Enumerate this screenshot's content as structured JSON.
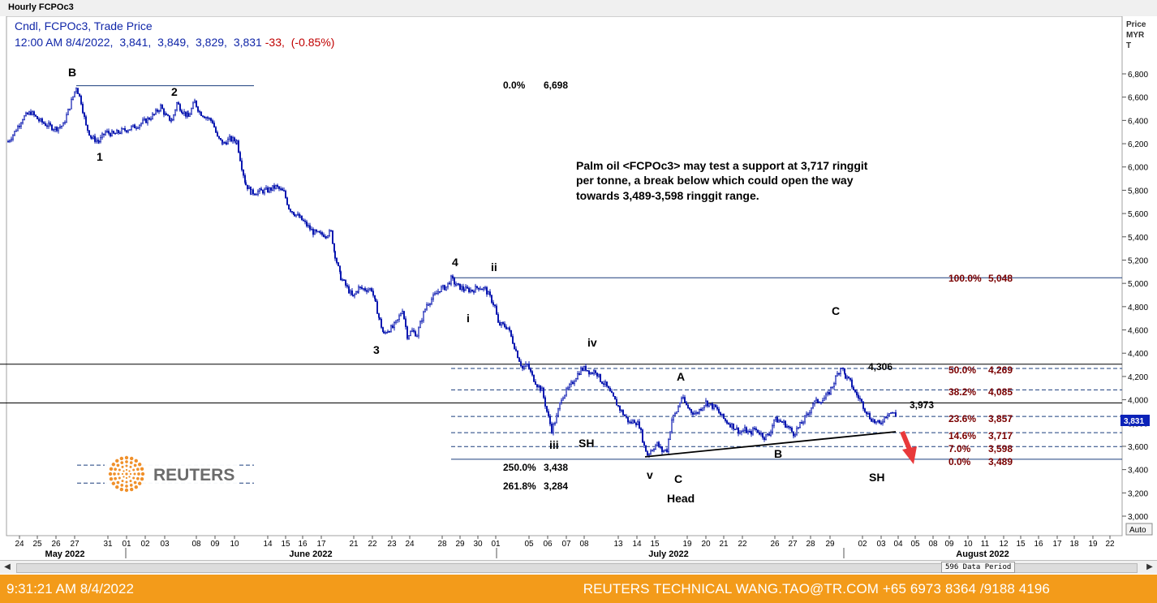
{
  "window": {
    "title": "Hourly FCPOc3"
  },
  "header": {
    "line1": "Cndl, FCPOc3, Trade Price",
    "time": "12:00 AM 8/4/2022,",
    "open": "3,841,",
    "high": "3,849,",
    "low": "3,829,",
    "close": "3,831",
    "change": "-33,",
    "change_pct": "(-0.85%)"
  },
  "axis": {
    "label_lines": [
      "Price",
      "MYR",
      "T"
    ],
    "ticks": [
      "6,800",
      "6,600",
      "6,400",
      "6,200",
      "6,000",
      "5,800",
      "5,600",
      "5,400",
      "5,200",
      "5,000",
      "4,800",
      "4,600",
      "4,400",
      "4,200",
      "4,000",
      "3,800",
      "3,600",
      "3,400",
      "3,200",
      "3,000"
    ],
    "current_price": "3,831",
    "auto_label": "Auto"
  },
  "date_axis": {
    "days": [
      {
        "l": "24",
        "x": 24
      },
      {
        "l": "25",
        "x": 46
      },
      {
        "l": "26",
        "x": 69
      },
      {
        "l": "27",
        "x": 92
      },
      {
        "l": "31",
        "x": 133
      },
      {
        "l": "01",
        "x": 156
      },
      {
        "l": "02",
        "x": 179
      },
      {
        "l": "03",
        "x": 203
      },
      {
        "l": "08",
        "x": 242
      },
      {
        "l": "09",
        "x": 265
      },
      {
        "l": "10",
        "x": 289
      },
      {
        "l": "14",
        "x": 330
      },
      {
        "l": "15",
        "x": 352
      },
      {
        "l": "16",
        "x": 373
      },
      {
        "l": "17",
        "x": 396
      },
      {
        "l": "21",
        "x": 436
      },
      {
        "l": "22",
        "x": 459
      },
      {
        "l": "23",
        "x": 483
      },
      {
        "l": "24",
        "x": 505
      },
      {
        "l": "28",
        "x": 545
      },
      {
        "l": "29",
        "x": 567
      },
      {
        "l": "30",
        "x": 589
      },
      {
        "l": "01",
        "x": 611
      },
      {
        "l": "05",
        "x": 652
      },
      {
        "l": "06",
        "x": 675
      },
      {
        "l": "07",
        "x": 698
      },
      {
        "l": "08",
        "x": 720
      },
      {
        "l": "13",
        "x": 762
      },
      {
        "l": "14",
        "x": 785
      },
      {
        "l": "15",
        "x": 807
      },
      {
        "l": "19",
        "x": 847
      },
      {
        "l": "20",
        "x": 870
      },
      {
        "l": "21",
        "x": 892
      },
      {
        "l": "22",
        "x": 915
      },
      {
        "l": "26",
        "x": 955
      },
      {
        "l": "27",
        "x": 977
      },
      {
        "l": "28",
        "x": 999
      },
      {
        "l": "29",
        "x": 1023
      },
      {
        "l": "02",
        "x": 1063
      },
      {
        "l": "03",
        "x": 1086
      },
      {
        "l": "04",
        "x": 1107
      },
      {
        "l": "05",
        "x": 1128
      },
      {
        "l": "08",
        "x": 1150
      },
      {
        "l": "09",
        "x": 1170
      },
      {
        "l": "10",
        "x": 1193
      },
      {
        "l": "11",
        "x": 1214
      },
      {
        "l": "12",
        "x": 1237
      },
      {
        "l": "15",
        "x": 1258
      },
      {
        "l": "16",
        "x": 1280
      },
      {
        "l": "17",
        "x": 1303
      },
      {
        "l": "18",
        "x": 1324
      },
      {
        "l": "19",
        "x": 1347
      },
      {
        "l": "22",
        "x": 1368
      }
    ],
    "months": [
      {
        "l": "May 2022",
        "x": 80
      },
      {
        "l": "June 2022",
        "x": 383
      },
      {
        "l": "July 2022",
        "x": 824
      },
      {
        "l": "August 2022",
        "x": 1211
      }
    ]
  },
  "chart_data": {
    "type": "candlestick",
    "instrument": "FCPOc3",
    "interval": "Hourly",
    "y_unit": "MYR/T",
    "ylim": [
      2960,
      6900
    ],
    "path": [
      {
        "x": 10,
        "y": 6220
      },
      {
        "x": 18,
        "y": 6300
      },
      {
        "x": 28,
        "y": 6420
      },
      {
        "x": 38,
        "y": 6470
      },
      {
        "x": 48,
        "y": 6400
      },
      {
        "x": 58,
        "y": 6360
      },
      {
        "x": 68,
        "y": 6330
      },
      {
        "x": 78,
        "y": 6360
      },
      {
        "x": 86,
        "y": 6520
      },
      {
        "x": 94,
        "y": 6690
      },
      {
        "x": 100,
        "y": 6560
      },
      {
        "x": 106,
        "y": 6350
      },
      {
        "x": 113,
        "y": 6250
      },
      {
        "x": 122,
        "y": 6220
      },
      {
        "x": 130,
        "y": 6300
      },
      {
        "x": 140,
        "y": 6280
      },
      {
        "x": 150,
        "y": 6310
      },
      {
        "x": 160,
        "y": 6330
      },
      {
        "x": 170,
        "y": 6360
      },
      {
        "x": 180,
        "y": 6400
      },
      {
        "x": 190,
        "y": 6450
      },
      {
        "x": 198,
        "y": 6520
      },
      {
        "x": 205,
        "y": 6430
      },
      {
        "x": 212,
        "y": 6400
      },
      {
        "x": 218,
        "y": 6550
      },
      {
        "x": 225,
        "y": 6480
      },
      {
        "x": 232,
        "y": 6430
      },
      {
        "x": 240,
        "y": 6560
      },
      {
        "x": 246,
        "y": 6470
      },
      {
        "x": 254,
        "y": 6430
      },
      {
        "x": 262,
        "y": 6390
      },
      {
        "x": 268,
        "y": 6250
      },
      {
        "x": 275,
        "y": 6200
      },
      {
        "x": 283,
        "y": 6240
      },
      {
        "x": 292,
        "y": 6220
      },
      {
        "x": 298,
        "y": 6000
      },
      {
        "x": 303,
        "y": 5850
      },
      {
        "x": 310,
        "y": 5780
      },
      {
        "x": 320,
        "y": 5790
      },
      {
        "x": 330,
        "y": 5800
      },
      {
        "x": 340,
        "y": 5830
      },
      {
        "x": 350,
        "y": 5780
      },
      {
        "x": 356,
        "y": 5650
      },
      {
        "x": 363,
        "y": 5600
      },
      {
        "x": 370,
        "y": 5560
      },
      {
        "x": 378,
        "y": 5500
      },
      {
        "x": 386,
        "y": 5440
      },
      {
        "x": 395,
        "y": 5420
      },
      {
        "x": 402,
        "y": 5420
      },
      {
        "x": 408,
        "y": 5440
      },
      {
        "x": 413,
        "y": 5240
      },
      {
        "x": 420,
        "y": 5050
      },
      {
        "x": 428,
        "y": 4960
      },
      {
        "x": 435,
        "y": 4880
      },
      {
        "x": 442,
        "y": 4960
      },
      {
        "x": 450,
        "y": 4950
      },
      {
        "x": 458,
        "y": 4950
      },
      {
        "x": 463,
        "y": 4820
      },
      {
        "x": 468,
        "y": 4680
      },
      {
        "x": 473,
        "y": 4560
      },
      {
        "x": 478,
        "y": 4600
      },
      {
        "x": 484,
        "y": 4620
      },
      {
        "x": 490,
        "y": 4680
      },
      {
        "x": 496,
        "y": 4780
      },
      {
        "x": 502,
        "y": 4550
      },
      {
        "x": 508,
        "y": 4590
      },
      {
        "x": 514,
        "y": 4560
      },
      {
        "x": 520,
        "y": 4700
      },
      {
        "x": 526,
        "y": 4820
      },
      {
        "x": 534,
        "y": 4880
      },
      {
        "x": 542,
        "y": 4950
      },
      {
        "x": 550,
        "y": 4970
      },
      {
        "x": 556,
        "y": 5040
      },
      {
        "x": 563,
        "y": 4980
      },
      {
        "x": 572,
        "y": 4950
      },
      {
        "x": 582,
        "y": 4940
      },
      {
        "x": 590,
        "y": 4970
      },
      {
        "x": 598,
        "y": 4950
      },
      {
        "x": 604,
        "y": 4880
      },
      {
        "x": 610,
        "y": 4800
      },
      {
        "x": 614,
        "y": 4650
      },
      {
        "x": 620,
        "y": 4640
      },
      {
        "x": 626,
        "y": 4620
      },
      {
        "x": 632,
        "y": 4500
      },
      {
        "x": 638,
        "y": 4380
      },
      {
        "x": 644,
        "y": 4270
      },
      {
        "x": 650,
        "y": 4300
      },
      {
        "x": 656,
        "y": 4200
      },
      {
        "x": 662,
        "y": 4130
      },
      {
        "x": 668,
        "y": 4080
      },
      {
        "x": 674,
        "y": 3900
      },
      {
        "x": 680,
        "y": 3740
      },
      {
        "x": 686,
        "y": 3850
      },
      {
        "x": 692,
        "y": 4020
      },
      {
        "x": 698,
        "y": 4070
      },
      {
        "x": 704,
        "y": 4130
      },
      {
        "x": 710,
        "y": 4200
      },
      {
        "x": 716,
        "y": 4260
      },
      {
        "x": 722,
        "y": 4270
      },
      {
        "x": 728,
        "y": 4230
      },
      {
        "x": 734,
        "y": 4250
      },
      {
        "x": 740,
        "y": 4170
      },
      {
        "x": 746,
        "y": 4130
      },
      {
        "x": 752,
        "y": 4060
      },
      {
        "x": 758,
        "y": 3990
      },
      {
        "x": 764,
        "y": 3920
      },
      {
        "x": 770,
        "y": 3860
      },
      {
        "x": 776,
        "y": 3800
      },
      {
        "x": 782,
        "y": 3820
      },
      {
        "x": 788,
        "y": 3780
      },
      {
        "x": 794,
        "y": 3600
      },
      {
        "x": 798,
        "y": 3530
      },
      {
        "x": 804,
        "y": 3580
      },
      {
        "x": 810,
        "y": 3620
      },
      {
        "x": 816,
        "y": 3560
      },
      {
        "x": 822,
        "y": 3570
      },
      {
        "x": 828,
        "y": 3830
      },
      {
        "x": 834,
        "y": 3900
      },
      {
        "x": 840,
        "y": 4020
      },
      {
        "x": 846,
        "y": 3950
      },
      {
        "x": 852,
        "y": 3900
      },
      {
        "x": 858,
        "y": 3880
      },
      {
        "x": 864,
        "y": 3930
      },
      {
        "x": 870,
        "y": 3980
      },
      {
        "x": 876,
        "y": 3950
      },
      {
        "x": 882,
        "y": 3930
      },
      {
        "x": 888,
        "y": 3870
      },
      {
        "x": 894,
        "y": 3820
      },
      {
        "x": 900,
        "y": 3790
      },
      {
        "x": 906,
        "y": 3760
      },
      {
        "x": 912,
        "y": 3720
      },
      {
        "x": 918,
        "y": 3740
      },
      {
        "x": 924,
        "y": 3710
      },
      {
        "x": 930,
        "y": 3750
      },
      {
        "x": 936,
        "y": 3720
      },
      {
        "x": 942,
        "y": 3680
      },
      {
        "x": 948,
        "y": 3700
      },
      {
        "x": 954,
        "y": 3830
      },
      {
        "x": 960,
        "y": 3820
      },
      {
        "x": 966,
        "y": 3800
      },
      {
        "x": 972,
        "y": 3760
      },
      {
        "x": 978,
        "y": 3710
      },
      {
        "x": 984,
        "y": 3760
      },
      {
        "x": 990,
        "y": 3820
      },
      {
        "x": 996,
        "y": 3880
      },
      {
        "x": 1002,
        "y": 3970
      },
      {
        "x": 1008,
        "y": 3990
      },
      {
        "x": 1014,
        "y": 4000
      },
      {
        "x": 1020,
        "y": 4040
      },
      {
        "x": 1026,
        "y": 4120
      },
      {
        "x": 1032,
        "y": 4220
      },
      {
        "x": 1037,
        "y": 4290
      },
      {
        "x": 1042,
        "y": 4200
      },
      {
        "x": 1048,
        "y": 4150
      },
      {
        "x": 1054,
        "y": 4060
      },
      {
        "x": 1060,
        "y": 4000
      },
      {
        "x": 1066,
        "y": 3920
      },
      {
        "x": 1072,
        "y": 3850
      },
      {
        "x": 1078,
        "y": 3810
      },
      {
        "x": 1084,
        "y": 3790
      },
      {
        "x": 1090,
        "y": 3850
      },
      {
        "x": 1096,
        "y": 3900
      },
      {
        "x": 1102,
        "y": 3880
      },
      {
        "x": 1106,
        "y": 3831
      }
    ],
    "horizontal_lines": [
      {
        "y": 6698,
        "x1": 94,
        "x2": 313,
        "color": "#1a3d7c",
        "style": "solid"
      },
      {
        "y": 5048,
        "x1": 556,
        "x2": 1383,
        "color": "#1a3d7c",
        "style": "solid"
      },
      {
        "y": 4306,
        "x1": 0,
        "x2": 1383,
        "color": "#000000",
        "style": "solid"
      },
      {
        "y": 3973,
        "x1": 0,
        "x2": 1383,
        "color": "#000000",
        "style": "solid"
      },
      {
        "y": 4269,
        "x1": 556,
        "x2": 1383,
        "color": "#1a3d7c",
        "style": "dashed"
      },
      {
        "y": 4085,
        "x1": 556,
        "x2": 1383,
        "color": "#1a3d7c",
        "style": "dashed"
      },
      {
        "y": 3857,
        "x1": 556,
        "x2": 1383,
        "color": "#1a3d7c",
        "style": "dashed"
      },
      {
        "y": 3717,
        "x1": 556,
        "x2": 1383,
        "color": "#1a3d7c",
        "style": "dashed"
      },
      {
        "y": 3598,
        "x1": 556,
        "x2": 1383,
        "color": "#1a3d7c",
        "style": "dashed"
      },
      {
        "y": 3489,
        "x1": 556,
        "x2": 1383,
        "color": "#1a3d7c",
        "style": "solid"
      },
      {
        "y": 3438,
        "x1": 95,
        "x2": 313,
        "color": "#1a3d7c",
        "style": "dashed"
      },
      {
        "y": 3284,
        "x1": 95,
        "x2": 313,
        "color": "#1a3d7c",
        "style": "dashed"
      }
    ],
    "trendline": {
      "x1": 795,
      "y1": 3510,
      "x2": 1104,
      "y2": 3725
    },
    "fib_retracement": [
      {
        "pct": "100.0%",
        "value": "5,048"
      },
      {
        "pct": "50.0%",
        "value": "4,269"
      },
      {
        "pct": "38.2%",
        "value": "4,085"
      },
      {
        "pct": "23.6%",
        "value": "3,857"
      },
      {
        "pct": "14.6%",
        "value": "3,717"
      },
      {
        "pct": "7.0%",
        "value": "3,598"
      },
      {
        "pct": "0.0%",
        "value": "3,489"
      }
    ],
    "fib_extension": [
      {
        "pct": "250.0%",
        "value": "3,438"
      },
      {
        "pct": "261.8%",
        "value": "3,284"
      }
    ],
    "top_level": {
      "pct": "0.0%",
      "value": "6,698"
    },
    "level_labels": [
      "4,306",
      "3,973"
    ],
    "wave_labels": [
      "B",
      "2",
      "1",
      "3",
      "4",
      "ii",
      "i",
      "iv",
      "iii",
      "SH",
      "v",
      "C",
      "Head",
      "A",
      "C",
      "B",
      "SH"
    ],
    "annotation": [
      "Palm oil <FCPOc3> may test a support at 3,717 ringgit",
      "per tonne, a break below which could open the way",
      "towards 3,489-3,598 ringgit range."
    ]
  },
  "logo": {
    "text": "REUTERS"
  },
  "scrollbar": {
    "data_period": "596 Data Period"
  },
  "footer": {
    "time": "9:31:21 AM 8/4/2022",
    "contact": "REUTERS TECHNICAL  WANG.TAO@TR.COM  +65 6973 8364 /9188 4196"
  },
  "colors": {
    "candle": "#0a18b0",
    "fib_label": "#7a0000",
    "header_text": "#1026a8",
    "change": "#c00000",
    "footer": "#f39b1a"
  }
}
